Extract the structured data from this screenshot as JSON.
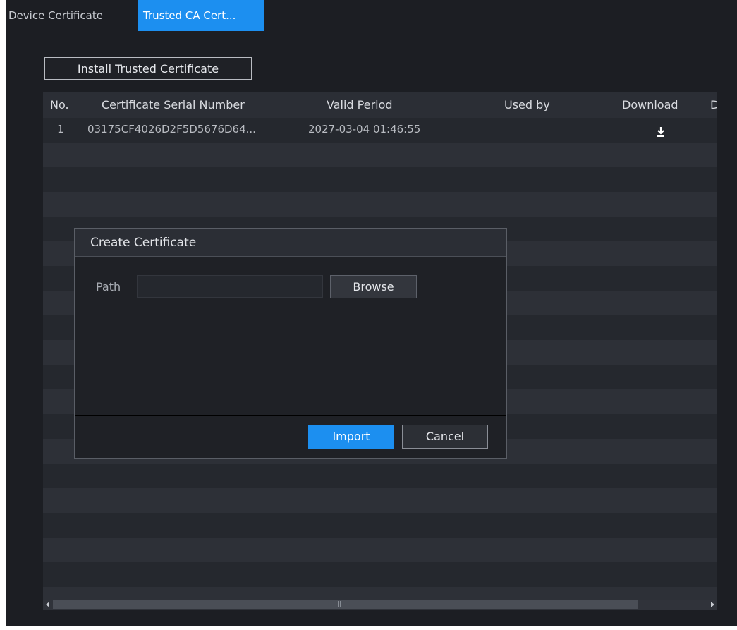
{
  "tabs": [
    {
      "label": "Device Certificate"
    },
    {
      "label": "Trusted CA Cert..."
    }
  ],
  "install_button": "Install Trusted Certificate",
  "table": {
    "columns": [
      "No.",
      "Certificate Serial Number",
      "Valid Period",
      "Used by",
      "Download",
      "D"
    ],
    "rows": [
      {
        "no": "1",
        "serial": "03175CF4026D2F5D5676D64...",
        "valid_period": "2027-03-04 01:46:55",
        "used_by": "",
        "download_icon": "download-icon"
      }
    ]
  },
  "dialog": {
    "title": "Create Certificate",
    "path_label": "Path",
    "path_value": "",
    "browse_label": "Browse",
    "import_label": "Import",
    "cancel_label": "Cancel"
  },
  "colors": {
    "accent": "#1c8ff0",
    "background": "#1c1e23"
  }
}
